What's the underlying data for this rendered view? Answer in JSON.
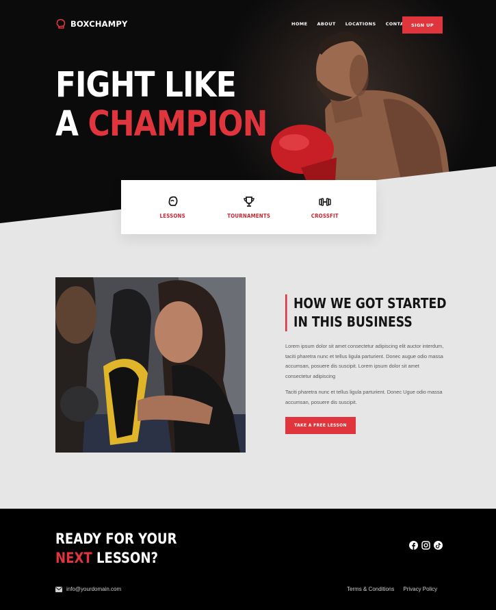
{
  "brand": {
    "name": "BOXCHAMPY"
  },
  "nav": {
    "items": [
      "HOME",
      "ABOUT",
      "LOCATIONS",
      "CONTACT"
    ],
    "signup_label": "SIGN UP"
  },
  "hero": {
    "line1": "FIGHT LIKE",
    "line2_prefix": "A ",
    "line2_accent": "CHAMPION"
  },
  "services": [
    {
      "label": "LESSONS",
      "icon": "boxing-glove-icon"
    },
    {
      "label": "TOURNAMENTS",
      "icon": "trophy-icon"
    },
    {
      "label": "CROSSFIT",
      "icon": "dumbbell-icon"
    }
  ],
  "about": {
    "title_line1": "HOW WE GOT STARTED",
    "title_line2": "IN THIS BUSINESS",
    "paragraph1": "Lorem ipsum dolor sit amet consectetur adipiscing elit auctor interdum, taciti pharetra nunc et tellus ligula parturient. Donec augue odio massa accumsan, posuere dis suscipit. Lorem ipsum dolor sit amet consectetur adipiscing",
    "paragraph2": "Taciti pharetra nunc et tellus ligula parturient. Donec Ugue odio massa accumsan, posuere dis suscipit.",
    "cta_label": "TAKE A FREE LESSON"
  },
  "footer": {
    "ready_line1": "READY FOR YOUR",
    "ready_accent": "NEXT",
    "ready_rest": " LESSON?",
    "email": "info@yourdomain.com",
    "links": [
      "Terms & Conditions",
      "Privacy Policy"
    ],
    "social_icons": [
      "facebook-icon",
      "instagram-icon",
      "tiktok-icon"
    ]
  },
  "colors": {
    "accent": "#e0353c",
    "dark": "#0b0b0c",
    "light_bg": "#e6e6e7"
  }
}
